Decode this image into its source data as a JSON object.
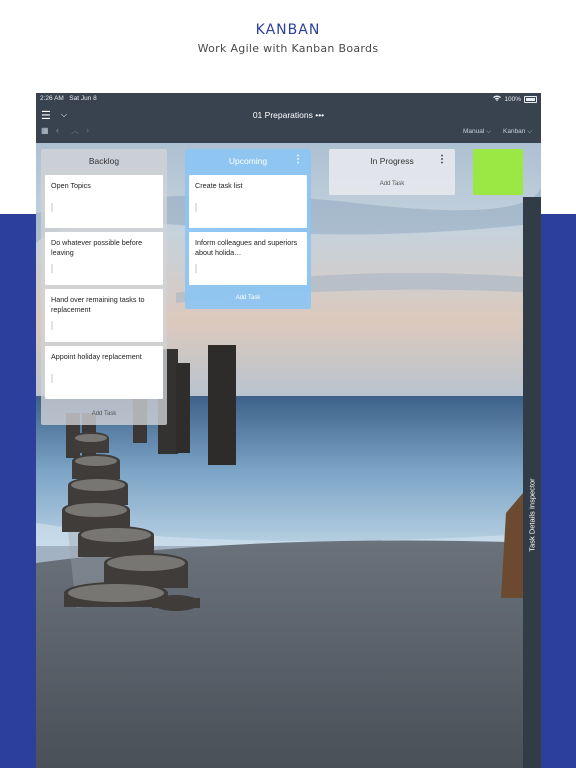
{
  "header": {
    "title": "KANBAN",
    "subtitle": "Work Agile with Kanban Boards"
  },
  "status_bar": {
    "time": "2:26 AM",
    "date": "Sat Jun 8",
    "battery": "100%"
  },
  "toolbar": {
    "document_title": "01 Preparations",
    "more": "•••",
    "sort_option": "Manual ⌵",
    "view_option": "Kanban ⌵"
  },
  "columns": [
    {
      "title": "Backlog",
      "add_label": "Add Task",
      "cards": [
        {
          "text": "Open Topics"
        },
        {
          "text": "Do whatever possible before leaving"
        },
        {
          "text": "Hand over remaining tasks to replacement"
        },
        {
          "text": "Appoint holiday replacement"
        }
      ]
    },
    {
      "title": "Upcoming",
      "add_label": "Add Task",
      "cards": [
        {
          "text": "Create task list"
        },
        {
          "text": "Inform colleagues and superiors about holida…"
        }
      ]
    },
    {
      "title": "In Progress",
      "add_label": "Add Task",
      "cards": []
    }
  ],
  "inspector": {
    "label": "Task Details Inspector"
  },
  "colors": {
    "brand_blue": "#2c3f9d",
    "upcoming_blue": "#8cc6f3",
    "green_column": "#9be844"
  }
}
